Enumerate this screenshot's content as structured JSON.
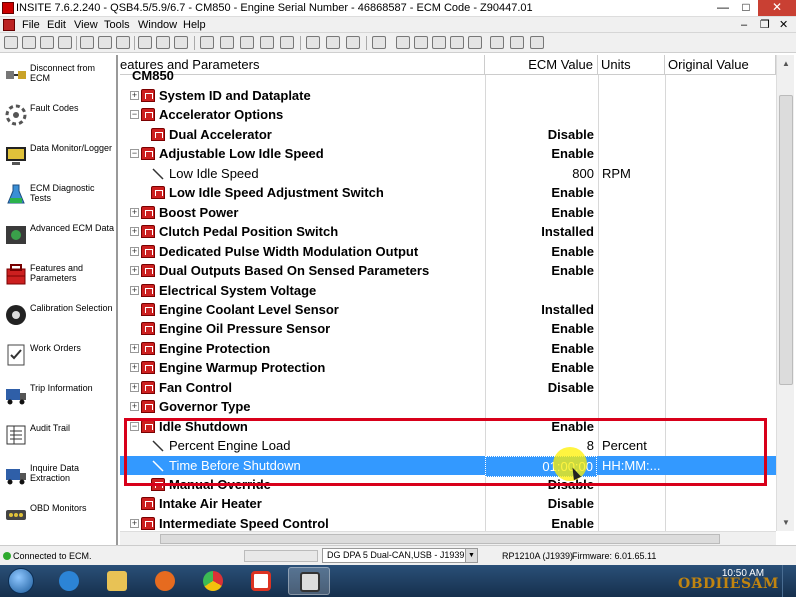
{
  "window": {
    "title": "INSITE 7.6.2.240  -  QSB4.5/5.9/6.7  -  CM850  -  Engine Serial Number  -  46868587  -  ECM Code  -  Z90447.01"
  },
  "menu": [
    "File",
    "Edit",
    "View",
    "Tools",
    "Window",
    "Help"
  ],
  "sidebar": {
    "items": [
      {
        "label": "Disconnect from ECM",
        "icon": "disconnect-icon"
      },
      {
        "label": "Fault Codes",
        "icon": "fault-codes-icon"
      },
      {
        "label": "Data Monitor/Logger",
        "icon": "data-monitor-icon"
      },
      {
        "label": "ECM Diagnostic Tests",
        "icon": "diagnostic-tests-icon"
      },
      {
        "label": "Advanced ECM Data",
        "icon": "advanced-ecm-icon"
      },
      {
        "label": "Features and Parameters",
        "icon": "features-parameters-icon"
      },
      {
        "label": "Calibration Selection",
        "icon": "calibration-icon"
      },
      {
        "label": "Work Orders",
        "icon": "work-orders-icon"
      },
      {
        "label": "Trip Information",
        "icon": "trip-information-icon"
      },
      {
        "label": "Audit Trail",
        "icon": "audit-trail-icon"
      },
      {
        "label": "Inquire Data Extraction",
        "icon": "inquire-data-icon"
      },
      {
        "label": "OBD Monitors",
        "icon": "obd-monitors-icon"
      }
    ]
  },
  "grid": {
    "headers": {
      "name": "eatures and Parameters",
      "value": "ECM Value",
      "units": "Units",
      "original": "Original Value"
    },
    "root": "CM850",
    "rows": [
      {
        "name": "System ID and Dataplate",
        "value": "",
        "units": "",
        "level": 0,
        "expander": "+",
        "icon": "group"
      },
      {
        "name": "Accelerator Options",
        "value": "",
        "units": "",
        "level": 0,
        "expander": "−",
        "icon": "group"
      },
      {
        "name": "Dual Accelerator",
        "value": "Disable",
        "units": "",
        "level": 1,
        "expander": "",
        "icon": "group"
      },
      {
        "name": "Adjustable Low Idle Speed",
        "value": "Enable",
        "units": "",
        "level": 0,
        "expander": "−",
        "icon": "group"
      },
      {
        "name": "Low Idle Speed",
        "value": "800",
        "units": "RPM",
        "level": 1,
        "expander": "",
        "icon": "param"
      },
      {
        "name": "Low Idle Speed Adjustment Switch",
        "value": "Enable",
        "units": "",
        "level": 1,
        "expander": "",
        "icon": "group"
      },
      {
        "name": "Boost Power",
        "value": "Enable",
        "units": "",
        "level": 0,
        "expander": "+",
        "icon": "group"
      },
      {
        "name": "Clutch Pedal Position Switch",
        "value": "Installed",
        "units": "",
        "level": 0,
        "expander": "+",
        "icon": "group"
      },
      {
        "name": "Dedicated Pulse Width Modulation Output",
        "value": "Enable",
        "units": "",
        "level": 0,
        "expander": "+",
        "icon": "group"
      },
      {
        "name": "Dual Outputs Based On Sensed Parameters",
        "value": "Enable",
        "units": "",
        "level": 0,
        "expander": "+",
        "icon": "group"
      },
      {
        "name": "Electrical System Voltage",
        "value": "",
        "units": "",
        "level": 0,
        "expander": "+",
        "icon": "group"
      },
      {
        "name": "Engine Coolant Level Sensor",
        "value": "Installed",
        "units": "",
        "level": 0,
        "expander": "",
        "icon": "group"
      },
      {
        "name": "Engine Oil Pressure Sensor",
        "value": "Enable",
        "units": "",
        "level": 0,
        "expander": "",
        "icon": "group"
      },
      {
        "name": "Engine Protection",
        "value": "Enable",
        "units": "",
        "level": 0,
        "expander": "+",
        "icon": "group"
      },
      {
        "name": "Engine Warmup Protection",
        "value": "Enable",
        "units": "",
        "level": 0,
        "expander": "+",
        "icon": "group"
      },
      {
        "name": "Fan Control",
        "value": "Disable",
        "units": "",
        "level": 0,
        "expander": "+",
        "icon": "group"
      },
      {
        "name": "Governor Type",
        "value": "",
        "units": "",
        "level": 0,
        "expander": "+",
        "icon": "group"
      },
      {
        "name": "Idle Shutdown",
        "value": "Enable",
        "units": "",
        "level": 0,
        "expander": "−",
        "icon": "group"
      },
      {
        "name": "Percent Engine Load",
        "value": "8",
        "units": "Percent",
        "level": 1,
        "expander": "",
        "icon": "param"
      },
      {
        "name": "Time Before Shutdown",
        "value": "01:00:00",
        "units": "HH:MM:...",
        "level": 1,
        "expander": "",
        "icon": "param",
        "selected": true
      },
      {
        "name": "Manual Override",
        "value": "Disable",
        "units": "",
        "level": 1,
        "expander": "",
        "icon": "group"
      },
      {
        "name": "Intake Air Heater",
        "value": "Disable",
        "units": "",
        "level": 0,
        "expander": "",
        "icon": "group"
      },
      {
        "name": "Intermediate Speed Control",
        "value": "Enable",
        "units": "",
        "level": 0,
        "expander": "+",
        "icon": "group"
      }
    ]
  },
  "status": {
    "connection": "Connected to ECM.",
    "adapter": "DG DPA 5 Dual-CAN,USB - J1939",
    "protocol": "RP1210A (J1939)",
    "firmware": "Firmware: 6.01.65.11"
  },
  "taskbar": {
    "clock": "10:50 AM",
    "apps": [
      "ie-icon",
      "explorer-icon",
      "media-player-icon",
      "chrome-icon",
      "app-icon",
      "insite-icon"
    ]
  },
  "watermark": "OBDIIESAM",
  "colors": {
    "selection": "#3399ff",
    "highlight_box": "#d8001a",
    "group_icon": "#cc1f1f"
  }
}
